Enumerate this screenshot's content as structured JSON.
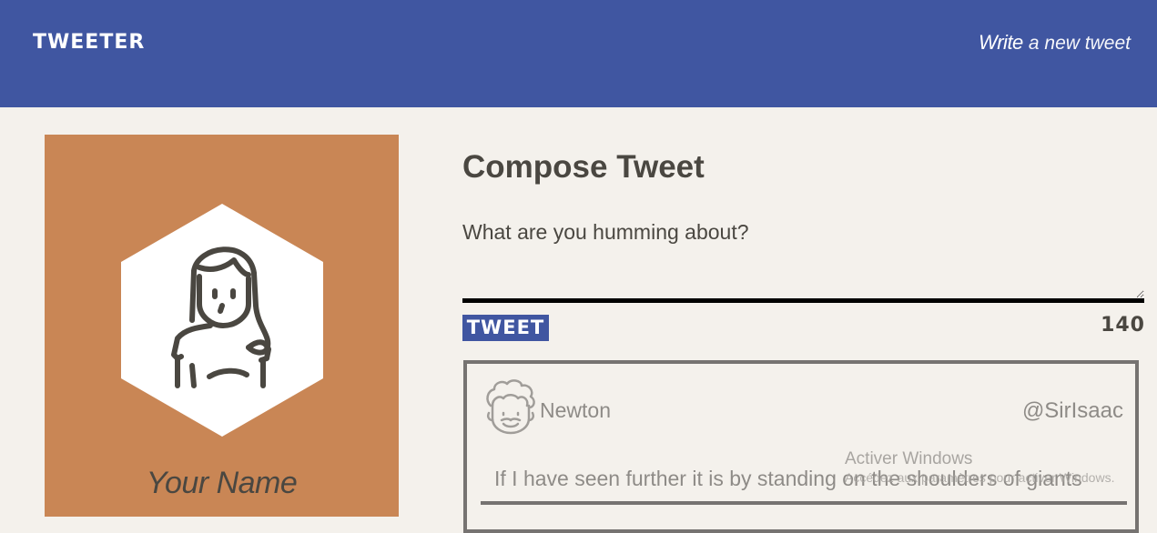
{
  "nav": {
    "brand": "TWEETER",
    "compose_strong": "Write",
    "compose_rest": "a new tweet"
  },
  "profile": {
    "name": "Your Name",
    "avatar_icon": "woman-avatar-icon"
  },
  "compose": {
    "title": "Compose Tweet",
    "placeholder": "What are you humming about?",
    "button_label": "TWEET",
    "counter": "140"
  },
  "tweet": {
    "author": "Newton",
    "handle": "@SirIsaac",
    "text": "If I have seen further it is by standing on the shoulders of giants",
    "avatar_icon": "curly-hair-avatar-icon"
  },
  "watermark": {
    "title": "Activer Windows",
    "subtitle": "Accédez aux paramètres pour activer Windows."
  },
  "colors": {
    "nav": "#4056a1",
    "background": "#f4f1ec",
    "profile_card": "#c98655",
    "text": "#4a4741",
    "muted": "#8e8b87"
  }
}
